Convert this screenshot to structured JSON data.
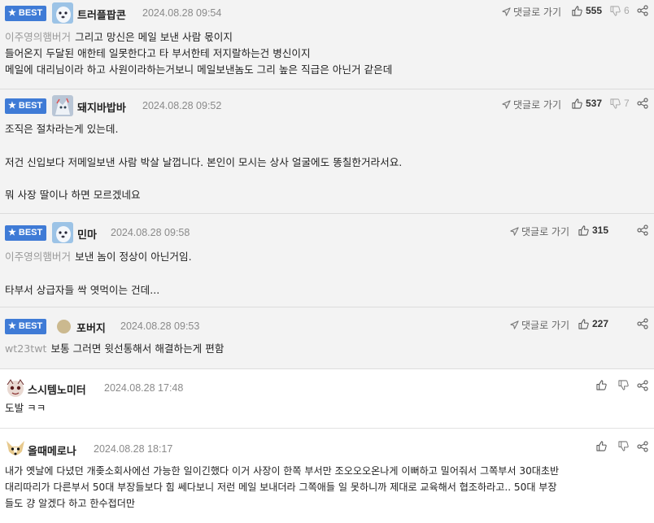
{
  "comments": [
    {
      "best_label": "BEST",
      "nick": "트러플팝콘",
      "date": "2024.08.28 09:54",
      "reply_label": "댓글로 가기",
      "up": "555",
      "down": "6",
      "mention": "이주영의햄버거",
      "lines": [
        "그리고 망신은 메일 보낸 사람 몫이지",
        "들어온지 두달된 애한테 일못한다고 타 부서한테 저지랄하는건 병신이지",
        "메일에 대리님이라 하고 사원이라하는거보니 메일보낸놈도 그리 높은 직급은 아닌거 같은데"
      ]
    },
    {
      "best_label": "BEST",
      "nick": "돼지바밥바",
      "date": "2024.08.28 09:52",
      "reply_label": "댓글로 가기",
      "up": "537",
      "down": "7",
      "lines": [
        "조직은 절차라는게 있는데.",
        "",
        "저건 신입보다 저메일보낸 사람 박살 날껍니다. 본인이 모시는 상사 얼굴에도 똥칠한거라서요.",
        "",
        "뭐 사장 딸이나 하면 모르겠네요"
      ]
    },
    {
      "best_label": "BEST",
      "nick": "민마",
      "date": "2024.08.28 09:58",
      "reply_label": "댓글로 가기",
      "up": "315",
      "mention": "이주영의햄버거",
      "lines": [
        "보낸 놈이 정상이 아닌거임.",
        "",
        "타부서 상급자들 싹 엿먹이는 건데..."
      ]
    },
    {
      "best_label": "BEST",
      "nick": "포버지",
      "date": "2024.08.28 09:53",
      "reply_label": "댓글로 가기",
      "up": "227",
      "mention": "wt23twt",
      "lines": [
        "보통 그러면 윗선통해서 해결하는게 편함"
      ]
    },
    {
      "nick": "스시템노미터",
      "date": "2024.08.28 17:48",
      "lines": [
        "도발 ㅋㅋ"
      ]
    },
    {
      "nick": "올때메로나",
      "date": "2024.08.28 18:17",
      "lines": [
        "내가 옛날에 다녔던 개좆소회사에선 가능한 일이긴했다 이거 사장이 한쪽 부서만 조오오오온나게 이뻐하고 밀어줘서 그쪽부서 30대초반",
        "대리따리가 다른부서 50대 부장들보다 힘 쎄다보니 저런 메일 보내더라 그쪽애들 일 못하니까 제대로 교육해서 협조하라고.. 50대 부장",
        "들도 걍 알겠다 하고 한수접더만"
      ]
    }
  ],
  "colors": {
    "best_badge": "#3f7bd6",
    "best_bg": "#f3f3f3",
    "mention": "#9a9a9a"
  },
  "icons": [
    "star-icon",
    "reply-arrow-icon",
    "thumbs-up-icon",
    "thumbs-down-icon",
    "share-icon"
  ]
}
